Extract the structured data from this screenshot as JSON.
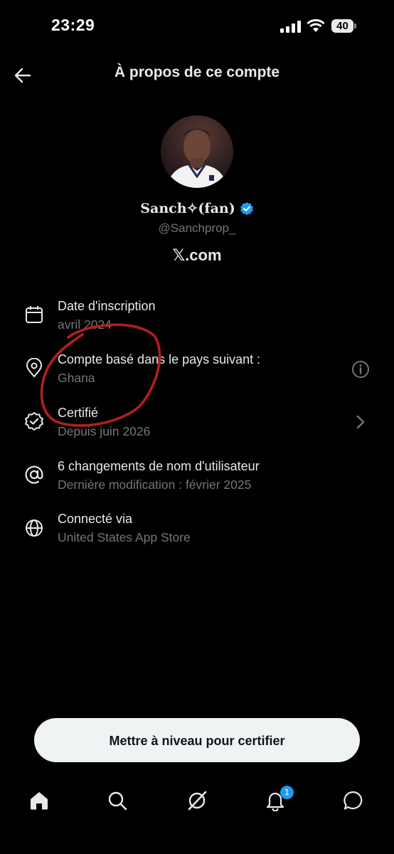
{
  "status_bar": {
    "time": "23:29",
    "battery": "40"
  },
  "header": {
    "title": "À propos de ce compte"
  },
  "profile": {
    "display_name": "Sanch✧(fan)",
    "handle": "@Sanchprop_",
    "site": "𝕏.com"
  },
  "rows": [
    {
      "icon": "calendar-icon",
      "title": "Date d'inscription",
      "subtitle": "avril 2024"
    },
    {
      "icon": "location-pin-icon",
      "title": "Compte basé dans le pays suivant :",
      "subtitle": "Ghana"
    },
    {
      "icon": "verified-badge-icon",
      "title": "Certifié",
      "subtitle": "Depuis juin 2026"
    },
    {
      "icon": "at-sign-icon",
      "title": "6 changements de nom d'utilisateur",
      "subtitle": "Dernière modification : février 2025"
    },
    {
      "icon": "globe-icon",
      "title": "Connecté via",
      "subtitle": "United States App Store"
    }
  ],
  "cta": {
    "label": "Mettre à niveau pour certifier"
  },
  "nav": {
    "notifications_badge": "1"
  },
  "colors": {
    "background": "#000000",
    "verified": "#1d9bf0",
    "annotation": "#b0201e",
    "muted": "#71767b"
  }
}
